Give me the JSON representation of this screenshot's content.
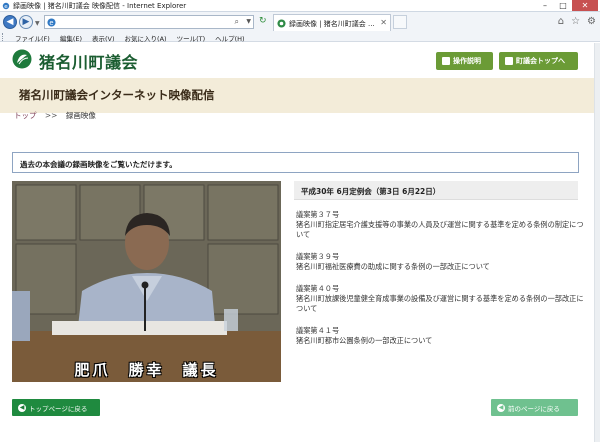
{
  "browser": {
    "window_title": "録画映像 | 猪名川町議会 映像配信 - Internet Explorer",
    "tab_title": "録画映像 | 猪名川町議会 ...",
    "menu": [
      "ファイル(F)",
      "編集(E)",
      "表示(V)",
      "お気に入り(A)",
      "ツール(T)",
      "ヘルプ(H)"
    ]
  },
  "header": {
    "site_name": "猪名川町議会",
    "guide_button": "操作説明",
    "top_button": "町議会トップへ"
  },
  "banner": {
    "title": "猪名川町議会インターネット映像配信"
  },
  "breadcrumb": {
    "home": "トップ",
    "separator": ">>",
    "current": "録画映像"
  },
  "notice": "過去の本会議の録画映像をご覧いただけます。",
  "video": {
    "caption": "肥爪　勝幸　議長"
  },
  "session": "平成30年 6月定例会（第3日 6月22日）",
  "items": [
    {
      "num": "議案第３７号",
      "desc": "猪名川町指定居宅介護支援等の事業の人員及び運営に関する基準を定める条例の制定について"
    },
    {
      "num": "議案第３９号",
      "desc": "猪名川町福祉医療費の助成に関する条例の一部改正について"
    },
    {
      "num": "議案第４０号",
      "desc": "猪名川町放課後児童健全育成事業の設備及び運営に関する基準を定める条例の一部改正について"
    },
    {
      "num": "議案第４１号",
      "desc": "猪名川町都市公園条例の一部改正について"
    }
  ],
  "footer": {
    "home_button": "トップページに戻る",
    "back_button": "前のページに戻る"
  },
  "colors": {
    "brand_green": "#1b5d31",
    "button_green": "#6b9b36",
    "banner_bg": "#f3ecd9"
  }
}
